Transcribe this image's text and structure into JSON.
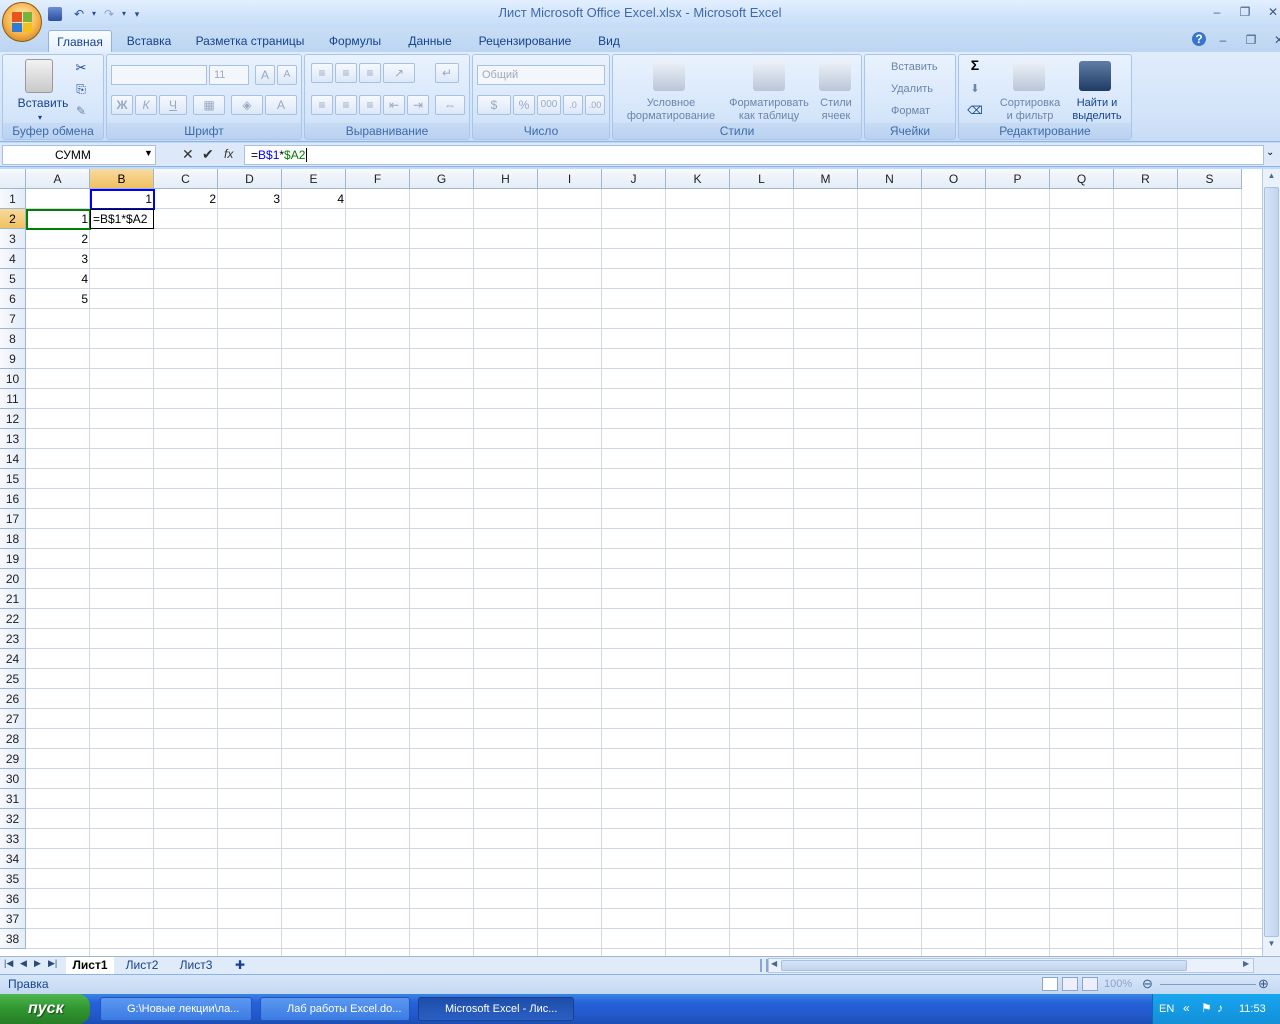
{
  "window": {
    "title": "Лист Microsoft Office Excel.xlsx - Microsoft Excel",
    "controls": [
      "–",
      "❐",
      "✕"
    ],
    "doc_controls": [
      "?",
      "–",
      "❐",
      "✕"
    ]
  },
  "qat": {
    "save_icon": "save-icon",
    "undo_icon": "undo-icon",
    "redo_icon": "redo-icon"
  },
  "tabs": [
    "Главная",
    "Вставка",
    "Разметка страницы",
    "Формулы",
    "Данные",
    "Рецензирование",
    "Вид"
  ],
  "active_tab": "Главная",
  "ribbon": {
    "clipboard": {
      "paste": "Вставить",
      "label": "Буфер обмена"
    },
    "font": {
      "label": "Шрифт",
      "size": "11",
      "bold": "Ж",
      "italic": "К",
      "underline": "Ч",
      "grow": "A",
      "shrink": "A"
    },
    "alignment": {
      "label": "Выравнивание"
    },
    "number": {
      "label": "Число",
      "format": "Общий",
      "percent": "%",
      "thousands": "000"
    },
    "styles": {
      "label": "Стили",
      "conditional_1": "Условное",
      "conditional_2": "форматирование",
      "table_1": "Форматировать",
      "table_2": "как таблицу",
      "cell_1": "Стили",
      "cell_2": "ячеек"
    },
    "cells": {
      "label": "Ячейки",
      "insert": "Вставить",
      "delete": "Удалить",
      "format": "Формат"
    },
    "editing": {
      "label": "Редактирование",
      "sum": "Σ",
      "sort_1": "Сортировка",
      "sort_2": "и фильтр",
      "find_1": "Найти и",
      "find_2": "выделить"
    }
  },
  "formula_bar": {
    "name_box": "СУММ",
    "fx": "fx",
    "formula": "=B$1*$A2",
    "formula_parts": [
      "=",
      "B$1",
      "*",
      "$A2"
    ]
  },
  "columns": [
    "A",
    "B",
    "C",
    "D",
    "E",
    "F",
    "G",
    "H",
    "I",
    "J",
    "K",
    "L",
    "M",
    "N",
    "O",
    "P",
    "Q",
    "R",
    "S"
  ],
  "rows": [
    "1",
    "2",
    "3",
    "4",
    "5",
    "6",
    "7",
    "8",
    "9",
    "10",
    "11",
    "12",
    "13",
    "14",
    "15",
    "16",
    "17",
    "18",
    "19",
    "20",
    "21",
    "22",
    "23",
    "24",
    "25",
    "26",
    "27",
    "28",
    "29",
    "30",
    "31",
    "32",
    "33",
    "34",
    "35",
    "36",
    "37",
    "38"
  ],
  "cells": [
    {
      "ref": "B1",
      "value": "1"
    },
    {
      "ref": "C1",
      "value": "2"
    },
    {
      "ref": "D1",
      "value": "3"
    },
    {
      "ref": "E1",
      "value": "4"
    },
    {
      "ref": "A2",
      "value": "1"
    },
    {
      "ref": "B2",
      "value": "=B$1*$A2"
    },
    {
      "ref": "A3",
      "value": "2"
    },
    {
      "ref": "A4",
      "value": "3"
    },
    {
      "ref": "A5",
      "value": "4"
    },
    {
      "ref": "A6",
      "value": "5"
    }
  ],
  "sheets": [
    "Лист1",
    "Лист2",
    "Лист3"
  ],
  "active_sheet": "Лист1",
  "status": {
    "mode": "Правка",
    "zoom": "100%"
  },
  "taskbar": {
    "start": "пуск",
    "items": [
      "G:\\Новые лекции\\ла...",
      "Лаб работы Excel.do...",
      "Microsoft Excel - Лис..."
    ],
    "active_index": 2,
    "lang": "EN",
    "time": "11:53"
  },
  "colors": {
    "ref_blue": "#0000ff",
    "ref_green": "#008000",
    "selected_header": "#f1c15f"
  }
}
